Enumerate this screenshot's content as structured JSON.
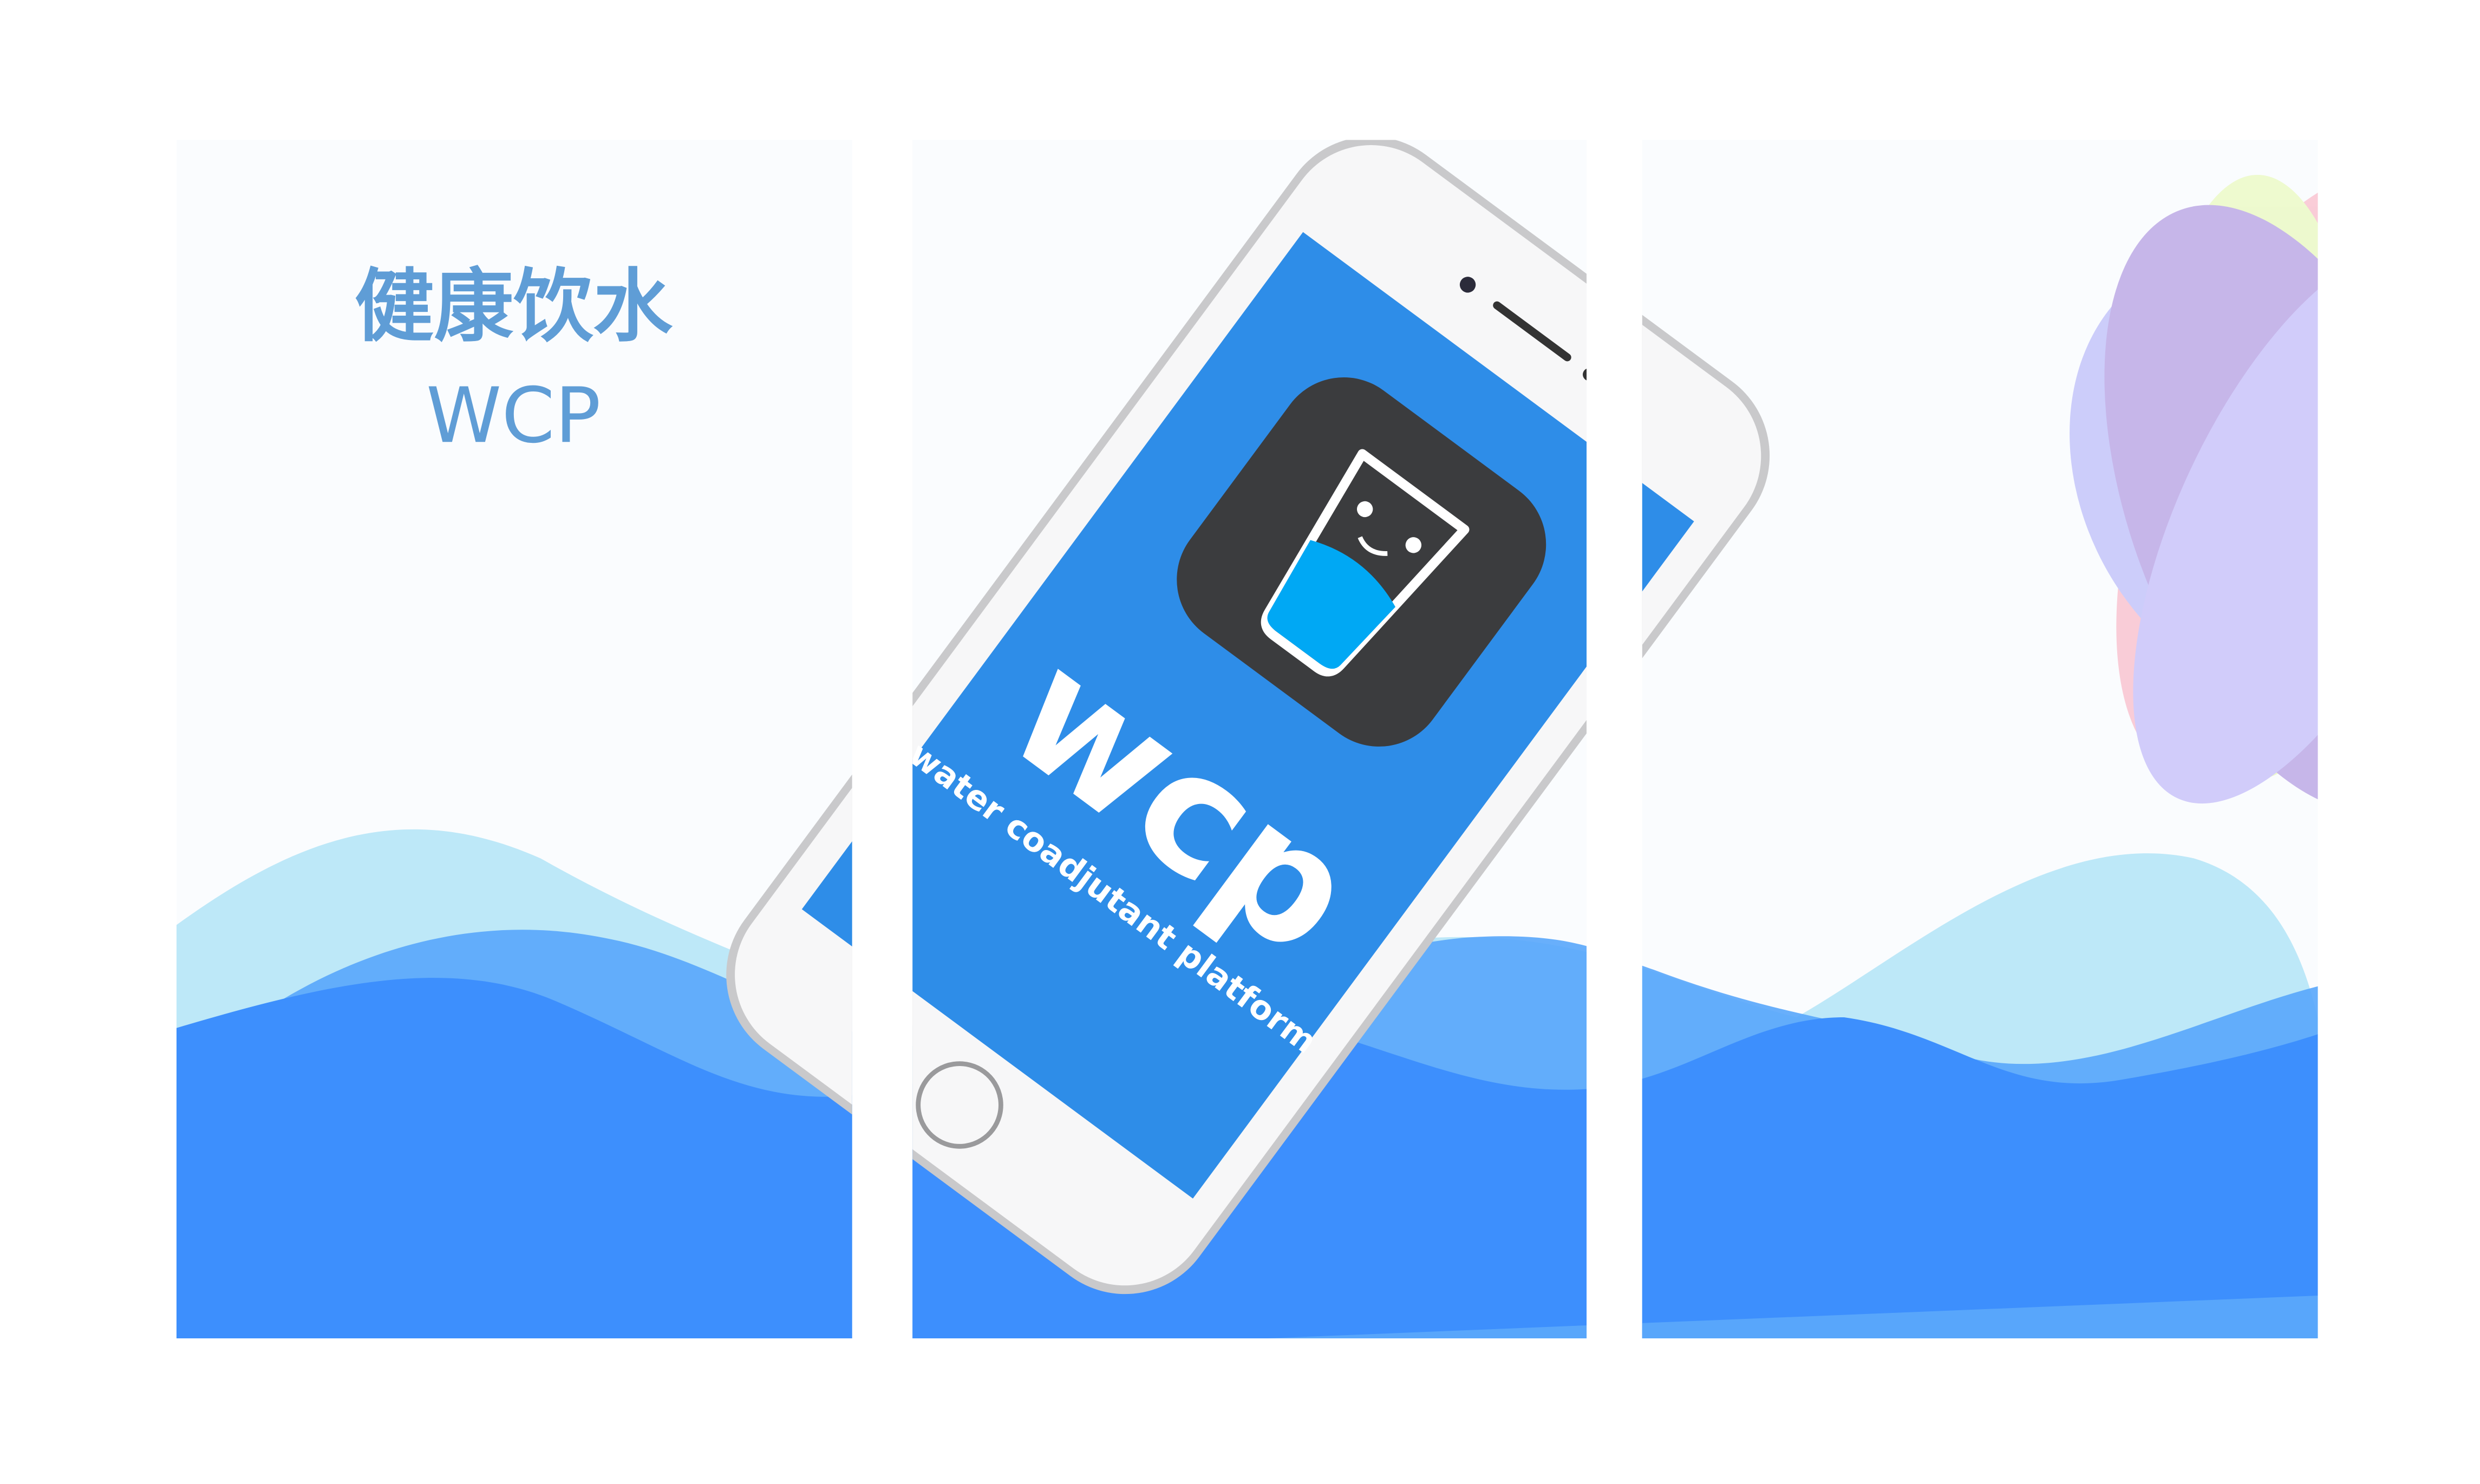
{
  "panel1": {
    "title_cn": "健康饮水",
    "title_en": "WCP"
  },
  "phone": {
    "app_name": "wcp",
    "tagline": "water coadjutant platform",
    "logo_icon": "smiling-water-glass-icon"
  },
  "colors": {
    "screen": "#2e8de8",
    "wave_light": "#bde8f8",
    "wave_mid": "#58a6fb",
    "wave_dark": "#3d8ffd",
    "title": "#5f9dd6",
    "logo_bg": "#3b3c3e",
    "water": "#00a8f4"
  }
}
